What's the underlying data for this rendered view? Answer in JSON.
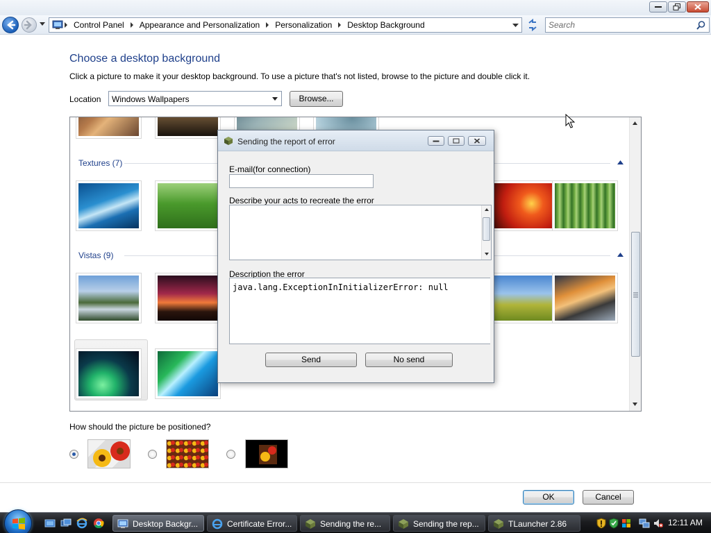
{
  "window": {
    "address": {
      "crumbs": [
        "Control Panel",
        "Appearance and Personalization",
        "Personalization",
        "Desktop Background"
      ]
    },
    "search": {
      "placeholder": "Search"
    }
  },
  "content": {
    "title": "Choose a desktop background",
    "instructions": "Click a picture to make it your desktop background. To use a picture that's not listed, browse to the picture and double click it.",
    "location_label": "Location",
    "location_value": "Windows Wallpapers",
    "browse_label": "Browse...",
    "groups": [
      {
        "name": "Textures (7)"
      },
      {
        "name": "Vistas (9)"
      }
    ],
    "position_label": "How should the picture be positioned?",
    "position_selected": 0
  },
  "footer": {
    "ok_label": "OK",
    "cancel_label": "Cancel"
  },
  "dialog": {
    "title": "Sending the report of error",
    "email_label": "E-mail(for connection)",
    "acts_label": "Describe your acts to recreate the error",
    "error_label": "Description the error",
    "error_text": "java.lang.ExceptionInInitializerError: null",
    "send_label": "Send",
    "nosend_label": "No send"
  },
  "taskbar": {
    "tasks": [
      {
        "label": "Desktop Backgr...",
        "active": true
      },
      {
        "label": "Certificate Error..."
      },
      {
        "label": "Sending the re..."
      },
      {
        "label": "Sending the rep..."
      },
      {
        "label": "TLauncher 2.86"
      }
    ],
    "clock": "12:11 AM"
  },
  "colors": {
    "link_blue": "#1e3f8a",
    "close_red": "#c84c33",
    "taskbar": "#1b1c1f"
  }
}
